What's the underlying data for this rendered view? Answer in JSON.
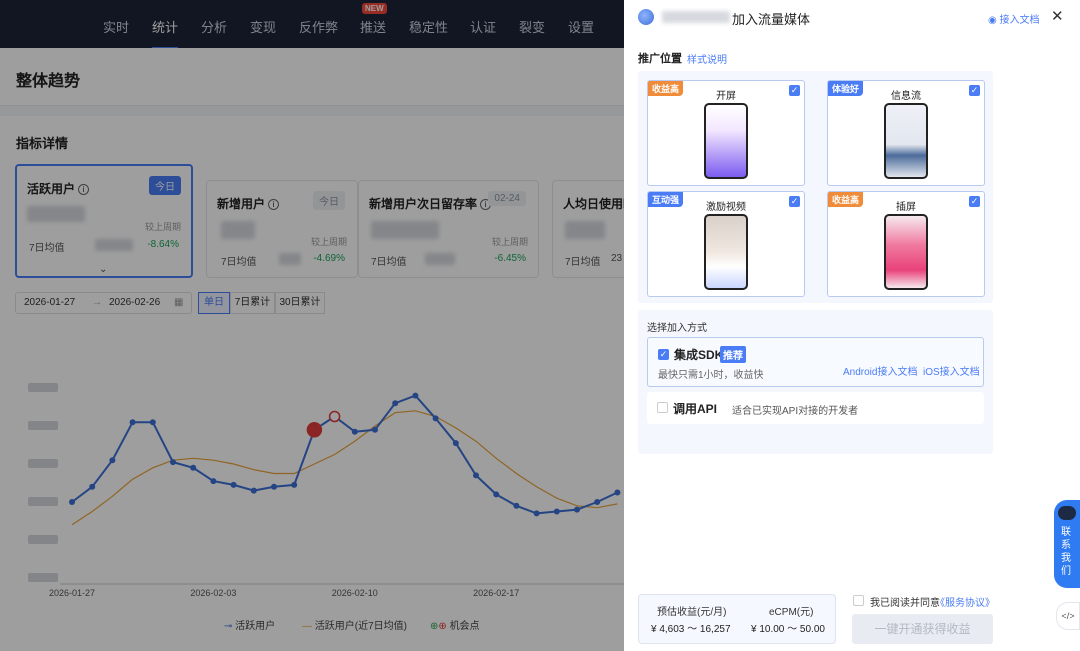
{
  "nav": {
    "items": [
      "实时",
      "统计",
      "分析",
      "变现",
      "反作弊",
      "推送",
      "稳定性",
      "认证",
      "裂变",
      "设置"
    ],
    "new_badge": "NEW"
  },
  "page_title": "整体趋势",
  "section_title": "指标详情",
  "cards": [
    {
      "title": "活跃用户",
      "tag": "今日",
      "compare_label": "较上周期",
      "avg_label": "7日均值",
      "change": "-8.64%"
    },
    {
      "title": "新增用户",
      "tag": "今日",
      "compare_label": "较上周期",
      "avg_label": "7日均值",
      "change": "-4.69%"
    },
    {
      "title": "新增用户次日留存率",
      "tag": "02-24",
      "compare_label": "较上周期",
      "avg_label": "7日均值",
      "change": "-6.45%"
    },
    {
      "title": "人均日使用时",
      "avg_label": "7日均值",
      "avg_value_partial": "23"
    }
  ],
  "date_range": {
    "start": "2026-01-27",
    "end": "2026-02-26"
  },
  "granularity": [
    "单日",
    "7日累计",
    "30日累计"
  ],
  "chart_data": {
    "type": "line",
    "x_ticks": [
      "2026-01-27",
      "2026-02-03",
      "2026-02-10",
      "2026-02-17",
      "202"
    ],
    "series": [
      {
        "name": "活跃用户",
        "color": "#3d6fd6",
        "values": [
          0.4,
          0.48,
          0.62,
          0.82,
          0.82,
          0.61,
          0.58,
          0.51,
          0.49,
          0.46,
          0.48,
          0.49,
          0.78,
          0.85,
          0.77,
          0.78,
          0.92,
          0.96,
          0.84,
          0.71,
          0.54,
          0.44,
          0.38,
          0.34,
          0.35,
          0.36,
          0.4,
          0.45
        ]
      },
      {
        "name": "活跃用户(近7日均值)",
        "color": "#e8a33a",
        "values": [
          0.28,
          0.35,
          0.43,
          0.52,
          0.58,
          0.62,
          0.63,
          0.62,
          0.6,
          0.57,
          0.55,
          0.55,
          0.6,
          0.65,
          0.72,
          0.8,
          0.87,
          0.88,
          0.85,
          0.79,
          0.72,
          0.63,
          0.55,
          0.48,
          0.42,
          0.38,
          0.37,
          0.39
        ]
      }
    ],
    "opportunity_points": [
      12,
      13
    ],
    "legend": [
      "活跃用户",
      "活跃用户(近7日均值)",
      "机会点"
    ]
  },
  "panel": {
    "title": "加入流量媒体",
    "doc_link": "接入文档",
    "position_label": "推广位置",
    "style_link": "样式说明",
    "positions": [
      {
        "ribbon": "收益高",
        "ribbon_color": "#f08b3a",
        "label": "开屏"
      },
      {
        "ribbon": "体验好",
        "ribbon_color": "#4a7cf6",
        "label": "信息流"
      },
      {
        "ribbon": "互动强",
        "ribbon_color": "#4a7cf6",
        "label": "激励视频"
      },
      {
        "ribbon": "收益高",
        "ribbon_color": "#f08b3a",
        "label": "插屏"
      }
    ],
    "method_label": "选择加入方式",
    "sdk": {
      "title": "集成SDK",
      "badge": "推荐",
      "desc": "最快只需1小时，收益快",
      "android_link": "Android接入文档",
      "ios_link": "iOS接入文档"
    },
    "api": {
      "title": "调用API",
      "desc": "适合已实现API对接的开发者"
    },
    "estimate": {
      "revenue_label": "预估收益(元/月)",
      "revenue_value": "¥ 4,603 ～ 16,257",
      "ecpm_label": "eCPM(元)",
      "ecpm_value": "¥ 10.00 ～ 50.00"
    },
    "agree_text": "我已阅读并同意",
    "agreement_link": "《服务协议》",
    "submit": "一键开通获得收益",
    "contact": [
      "联",
      "系",
      "我",
      "们"
    ]
  }
}
